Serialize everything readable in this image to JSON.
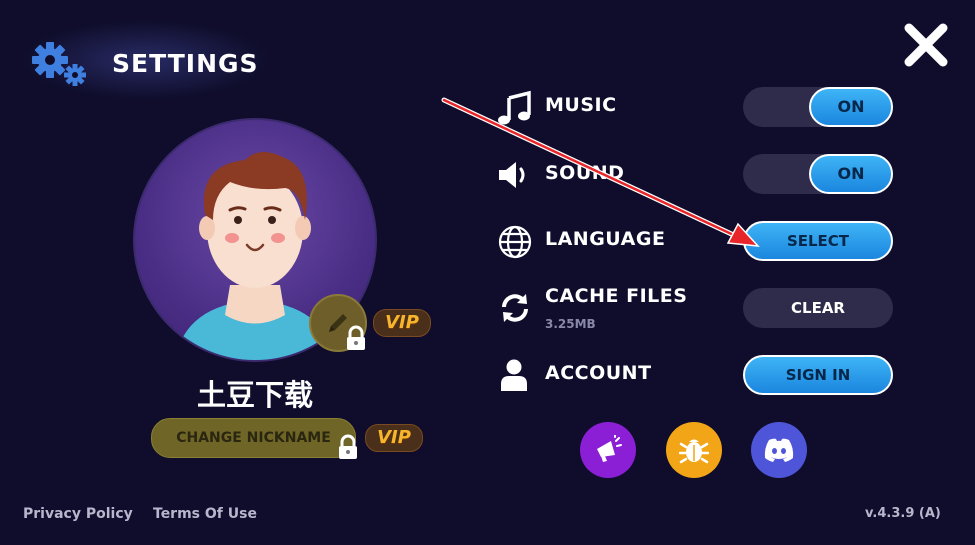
{
  "header": {
    "title": "SETTINGS",
    "icon": "gears-icon"
  },
  "profile": {
    "nickname": "土豆下载",
    "change_nickname_label": "CHANGE NICKNAME",
    "vip_label": "VIP"
  },
  "settings": {
    "music": {
      "label": "MUSIC",
      "value": "ON"
    },
    "sound": {
      "label": "SOUND",
      "value": "ON"
    },
    "language": {
      "label": "LANGUAGE",
      "button": "SELECT"
    },
    "cache": {
      "label": "CACHE FILES",
      "size": "3.25MB",
      "button": "CLEAR"
    },
    "account": {
      "label": "ACCOUNT",
      "button": "SIGN IN"
    }
  },
  "social": [
    {
      "name": "announcements",
      "icon": "megaphone-icon",
      "color": "#8a1fd6"
    },
    {
      "name": "report-bug",
      "icon": "bug-icon",
      "color": "#f2a516"
    },
    {
      "name": "discord",
      "icon": "discord-icon",
      "color": "#4e55d8"
    }
  ],
  "footer": {
    "privacy": "Privacy Policy",
    "terms": "Terms Of Use",
    "version": "v.4.3.9 (A)"
  },
  "colors": {
    "accent": "#1e98e8",
    "background": "#0f0d2b",
    "vip": "#f6b52c",
    "arrow": "#e8262a"
  }
}
